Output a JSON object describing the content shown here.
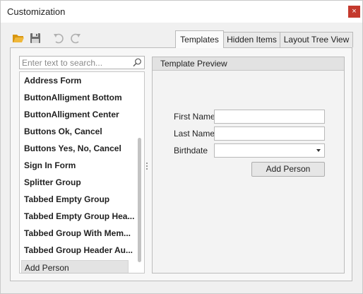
{
  "window": {
    "title": "Customization",
    "close_glyph": "×"
  },
  "toolbar": {
    "icons": [
      "open-folder-icon",
      "save-icon",
      "undo-icon",
      "redo-icon"
    ]
  },
  "tabs": [
    {
      "label": "Templates",
      "active": true
    },
    {
      "label": "Hidden Items",
      "active": false
    },
    {
      "label": "Layout Tree View",
      "active": false
    }
  ],
  "search": {
    "placeholder": "Enter text to search...",
    "value": ""
  },
  "templates": {
    "items": [
      "Address Form",
      "ButtonAlligment Bottom",
      "ButtonAlligment Center",
      "Buttons Ok, Cancel",
      "Buttons Yes, No, Cancel",
      "Sign In Form",
      "Splitter Group",
      "Tabbed Empty Group",
      "Tabbed Empty Group Hea...",
      "Tabbed Group With Mem...",
      "Tabbed Group Header Au..."
    ],
    "selected": "Add Person"
  },
  "preview": {
    "header": "Template Preview",
    "fields": [
      {
        "label": "First Name",
        "value": ""
      },
      {
        "label": "Last Name",
        "value": ""
      },
      {
        "label": "Birthdate",
        "value": ""
      }
    ],
    "button": "Add Person"
  },
  "colors": {
    "close_button": "#c4392d",
    "folder_icon": "#e8a317",
    "selected_item_bg": "#e3e3e3"
  }
}
